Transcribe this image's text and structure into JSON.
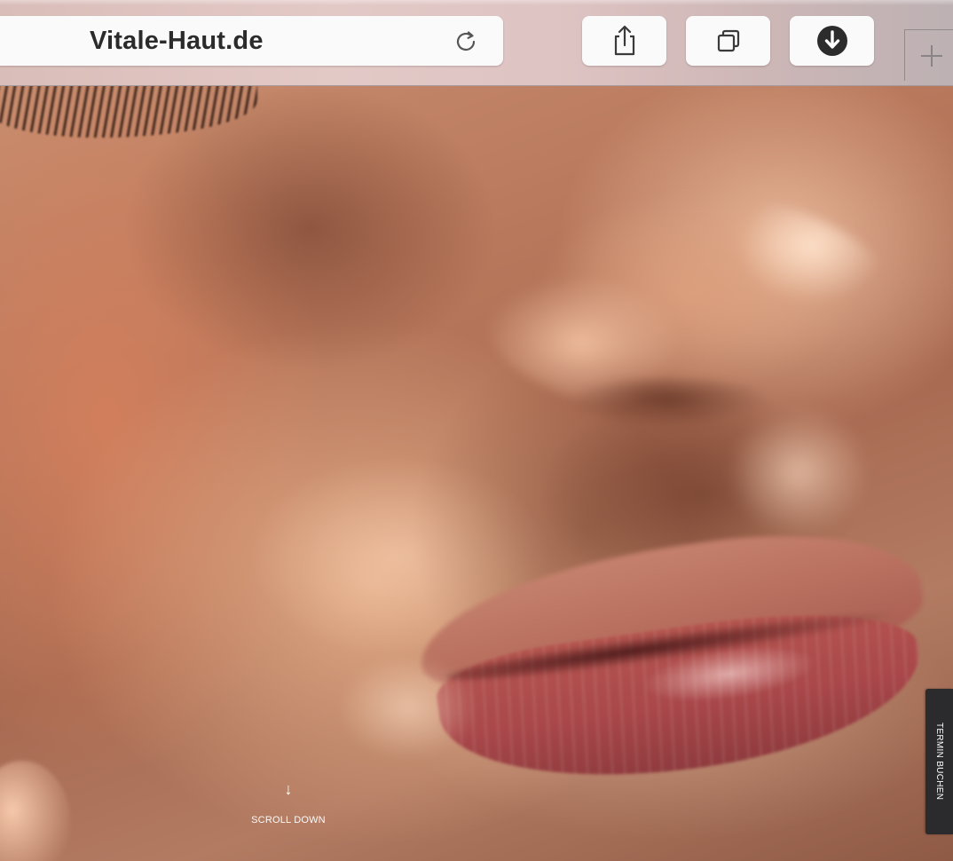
{
  "browser": {
    "url": "Vitale-Haut.de",
    "icons": {
      "reload": "reload-icon",
      "share": "share-icon",
      "tabs": "tabs-icon",
      "download": "download-icon",
      "new_tab": "plus-icon"
    }
  },
  "page": {
    "hero_image": "close-up-face-photo",
    "scroll_down": {
      "arrow": "↓",
      "label": "SCROLL DOWN"
    },
    "side_tab_label": "TERMIN BUCHEN"
  },
  "colors": {
    "toolbar": "#ddc3c2",
    "button_bg": "#fbfafa",
    "side_tab_bg": "#2b2b2d",
    "text_dark": "#2b2b2b"
  }
}
